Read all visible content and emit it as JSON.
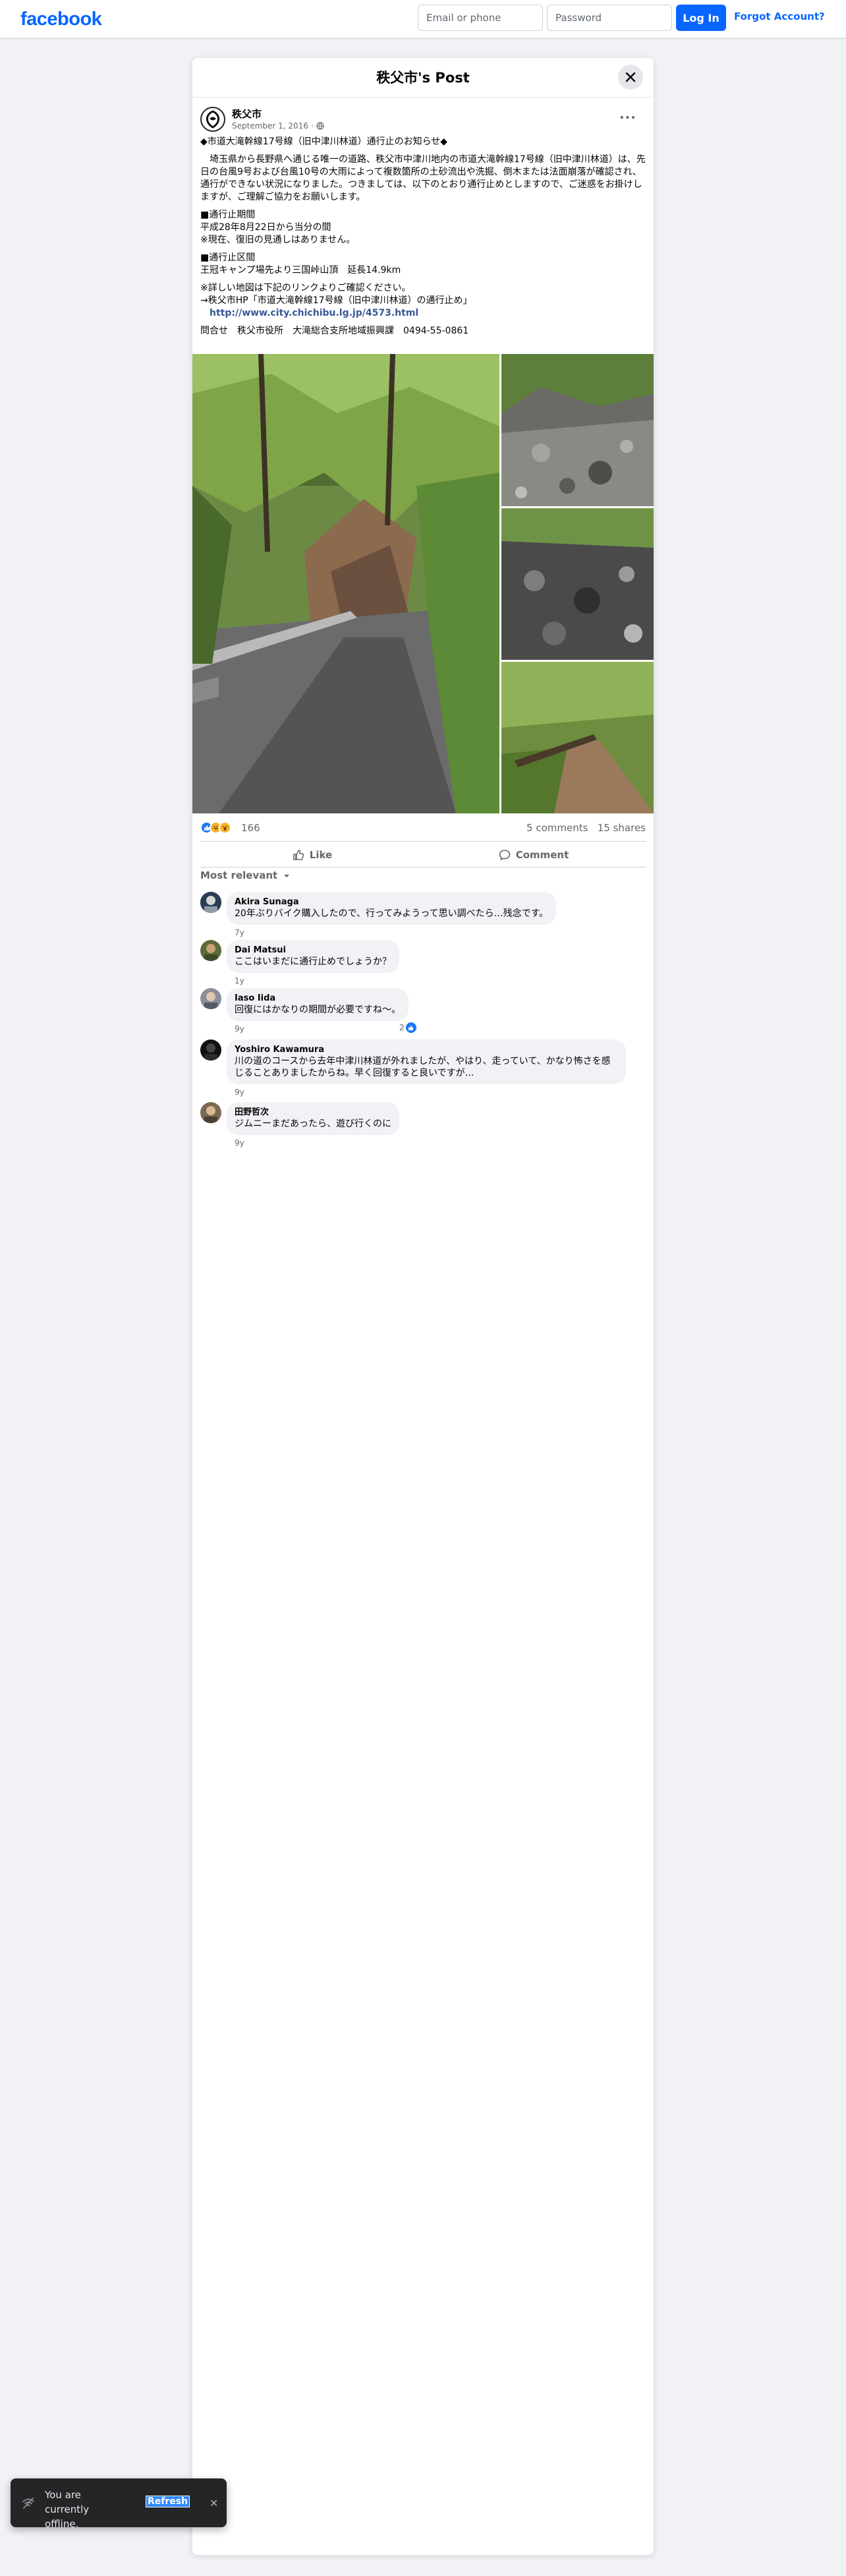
{
  "header": {
    "logo": "facebook",
    "email_placeholder": "Email or phone",
    "password_placeholder": "Password",
    "login_label": "Log In",
    "forgot_label": "Forgot Account?"
  },
  "modal": {
    "title": "秩父市's Post"
  },
  "post": {
    "author": "秩父市",
    "date": "September 1, 2016",
    "privacy_glyph": "·",
    "paragraphs": [
      "◆市道大滝幹線17号線（旧中津川林道）通行止のお知らせ◆",
      "　埼玉県から長野県へ通じる唯一の道路、秩父市中津川地内の市道大滝幹線17号線（旧中津川林道）は、先日の台風9号および台風10号の大雨によって複数箇所の土砂流出や洗掘、倒木または法面崩落が確認され、通行ができない状況になりました。つきましては、以下のとおり通行止めとしますので、ご迷惑をお掛けしますが、ご理解ご協力をお願いします。",
      "■通行止期間\n平成28年8月22日から当分の間\n※現在、復旧の見通しはありません。",
      "■通行止区間\n王冠キャンプ場先より三国峠山頂　延長14.9km",
      "※詳しい地図は下記のリンクよりご確認ください。\n→秩父市HP「市道大滝幹線17号線（旧中津川林道）の通行止め」"
    ],
    "link": "http://www.city.chichibu.lg.jp/4573.html",
    "contact": "問合せ　秩父市役所　大滝総合支所地域振興課　0494-55-0861"
  },
  "stats": {
    "reaction_count": "166",
    "comments": "5 comments",
    "shares": "15 shares"
  },
  "actions": {
    "like": "Like",
    "comment": "Comment"
  },
  "sort_label": "Most relevant",
  "comments": [
    {
      "name": "Akira Sunaga",
      "text": "20年ぶりバイク購入したので、行ってみようって思い調べたら…残念です。",
      "time": "7y"
    },
    {
      "name": "Dai Matsui",
      "text": "ここはいまだに通行止めでしょうか？",
      "time": "1y"
    },
    {
      "name": "Iaso Iida",
      "text": "回復にはかなりの期間が必要ですね〜。",
      "time": "9y",
      "reactions": "2"
    },
    {
      "name": "Yoshiro Kawamura",
      "text": "川の道のコースから去年中津川林道が外れましたが、やはり、走っていて、かなり怖さを感じることありましたからね。早く回復すると良いですが…",
      "time": "9y"
    },
    {
      "name": "田野哲次",
      "text": "ジムニーまだあったら、遊び行くのに",
      "time": "9y"
    }
  ],
  "toast": {
    "message": "You are currently offline.",
    "refresh": "Refresh"
  }
}
